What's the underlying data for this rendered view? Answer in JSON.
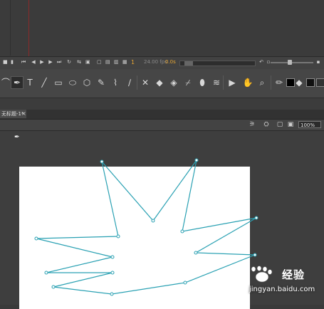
{
  "timeline": {
    "current_frame": "1",
    "fps": "24.00 fps",
    "elapsed": "0.0s"
  },
  "tools": [
    "lasso-icon",
    "pen-icon",
    "text-icon",
    "line-icon",
    "rectangle-icon",
    "oval-icon",
    "polystar-icon",
    "pencil-icon",
    "brush-icon",
    "brush-alt-icon",
    "bone-icon",
    "paint-bucket-icon",
    "ink-bottle-icon",
    "eyedropper-icon",
    "eraser-icon",
    "width-icon",
    "camera-icon",
    "hand-icon",
    "zoom-icon"
  ],
  "document": {
    "tab_title": "无标题-1*",
    "close_glyph": "×"
  },
  "edit_bar": {
    "zoom_value": "100%"
  },
  "watermark": {
    "brand": "经验",
    "url": "jingyan.baidu.com"
  },
  "colors": {
    "path_stroke": "#2aa1b3",
    "playhead": "#8a2a2a",
    "accent_orange": "#e6a532"
  }
}
